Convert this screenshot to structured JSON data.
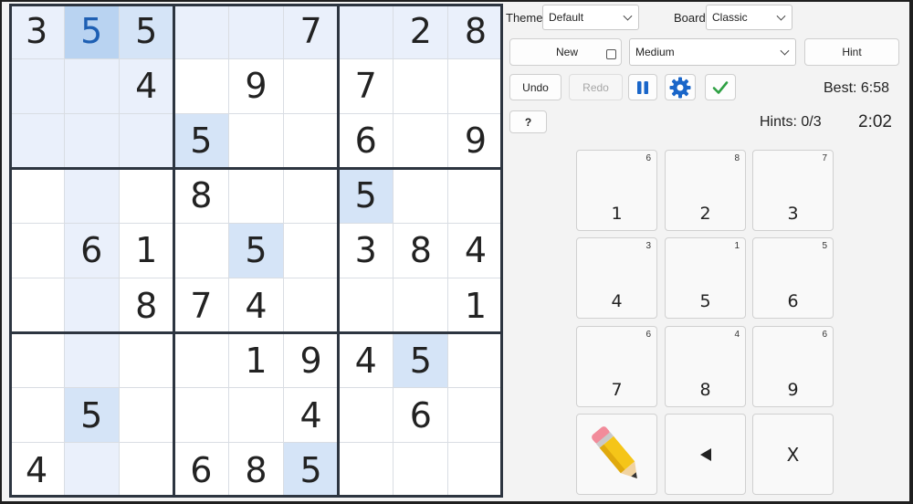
{
  "board": {
    "grid": [
      [
        "3",
        "5",
        "5",
        "",
        "",
        "7",
        "",
        "2",
        "8"
      ],
      [
        "",
        "",
        "4",
        "",
        "9",
        "",
        "7",
        "",
        ""
      ],
      [
        "",
        "",
        "",
        "5",
        "",
        "",
        "6",
        "",
        "9"
      ],
      [
        "",
        "",
        "",
        "8",
        "",
        "",
        "5",
        "",
        ""
      ],
      [
        "",
        "6",
        "1",
        "",
        "5",
        "",
        "3",
        "8",
        "4"
      ],
      [
        "",
        "",
        "8",
        "7",
        "4",
        "",
        "",
        "",
        "1"
      ],
      [
        "",
        "",
        "",
        "",
        "1",
        "9",
        "4",
        "5",
        ""
      ],
      [
        "",
        "5",
        "",
        "",
        "",
        "4",
        "",
        "6",
        ""
      ],
      [
        "4",
        "",
        "",
        "6",
        "8",
        "5",
        "",
        "",
        ""
      ]
    ],
    "selected": [
      0,
      1
    ]
  },
  "theme": {
    "label": "Theme",
    "value": "Default"
  },
  "board_style": {
    "label": "Board",
    "value": "Classic"
  },
  "buttons": {
    "new": "New",
    "hint": "Hint",
    "undo": "Undo",
    "redo": "Redo",
    "help": "?"
  },
  "difficulty": "Medium",
  "status": {
    "best": "Best: 6:58",
    "hints": "Hints: 0/3",
    "timer": "2:02"
  },
  "colors": {
    "accent": "#1a66c9",
    "check": "#2ea043"
  },
  "icons": {
    "pause": "pause-icon",
    "settings": "gear-icon",
    "check": "check-icon",
    "pencil": "pencil-icon",
    "back": "left-triangle-icon"
  },
  "numpad": [
    {
      "digit": "1",
      "remaining": "6"
    },
    {
      "digit": "2",
      "remaining": "8"
    },
    {
      "digit": "3",
      "remaining": "7"
    },
    {
      "digit": "4",
      "remaining": "3"
    },
    {
      "digit": "5",
      "remaining": "1"
    },
    {
      "digit": "6",
      "remaining": "5"
    },
    {
      "digit": "7",
      "remaining": "6"
    },
    {
      "digit": "8",
      "remaining": "4"
    },
    {
      "digit": "9",
      "remaining": "6"
    }
  ],
  "erase_label": "X"
}
